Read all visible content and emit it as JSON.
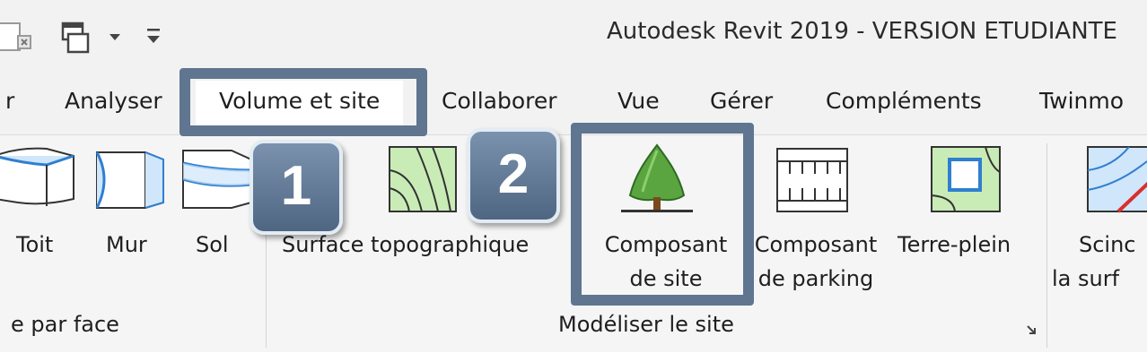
{
  "window": {
    "title": "Autodesk Revit 2019 - VERSION ETUDIANTE"
  },
  "quick_access": {
    "icons": [
      "document-icon",
      "switch-windows-icon",
      "dropdown-arrow-icon",
      "customize-toolbar-icon"
    ]
  },
  "tabs": [
    {
      "label": "r",
      "partial": true
    },
    {
      "label": "Analyser"
    },
    {
      "label": "Volume et site",
      "active": true
    },
    {
      "label": "Collaborer"
    },
    {
      "label": "Vue"
    },
    {
      "label": "Gérer"
    },
    {
      "label": "Compléments"
    },
    {
      "label": "Twinmo",
      "partial": true
    }
  ],
  "ribbon": {
    "face_group": {
      "buttons": [
        {
          "label": "Toit",
          "icon": "roof-by-face-icon"
        },
        {
          "label": "Mur",
          "icon": "wall-by-face-icon"
        },
        {
          "label": "Sol",
          "icon": "floor-by-face-icon"
        }
      ],
      "group_label": "e par face"
    },
    "site_group": {
      "buttons": [
        {
          "label": "Surface topographique",
          "icon": "toposurface-icon"
        },
        {
          "label_line1": "Composant",
          "label_line2": "de site",
          "icon": "tree-icon"
        },
        {
          "label_line1": "Composant",
          "label_line2": "de parking",
          "icon": "parking-icon"
        },
        {
          "label": "Terre-plein",
          "icon": "building-pad-icon"
        }
      ],
      "group_label": "Modéliser le site",
      "launcher_icon": "dialog-launcher-icon"
    },
    "modify_group": {
      "buttons": [
        {
          "label_line1": "Scinc",
          "label_line2": "la surf",
          "icon": "split-surface-icon"
        }
      ]
    }
  },
  "callouts": [
    {
      "number": "1",
      "target": "Volume et site"
    },
    {
      "number": "2",
      "target": "Composant de site"
    }
  ],
  "colors": {
    "callout": "#5f7590",
    "ribbon_bg": "#f5f5f5",
    "icon_blue": "#2f7fcf",
    "icon_green": "#c9ecb6",
    "tree_green": "#5aa540"
  }
}
